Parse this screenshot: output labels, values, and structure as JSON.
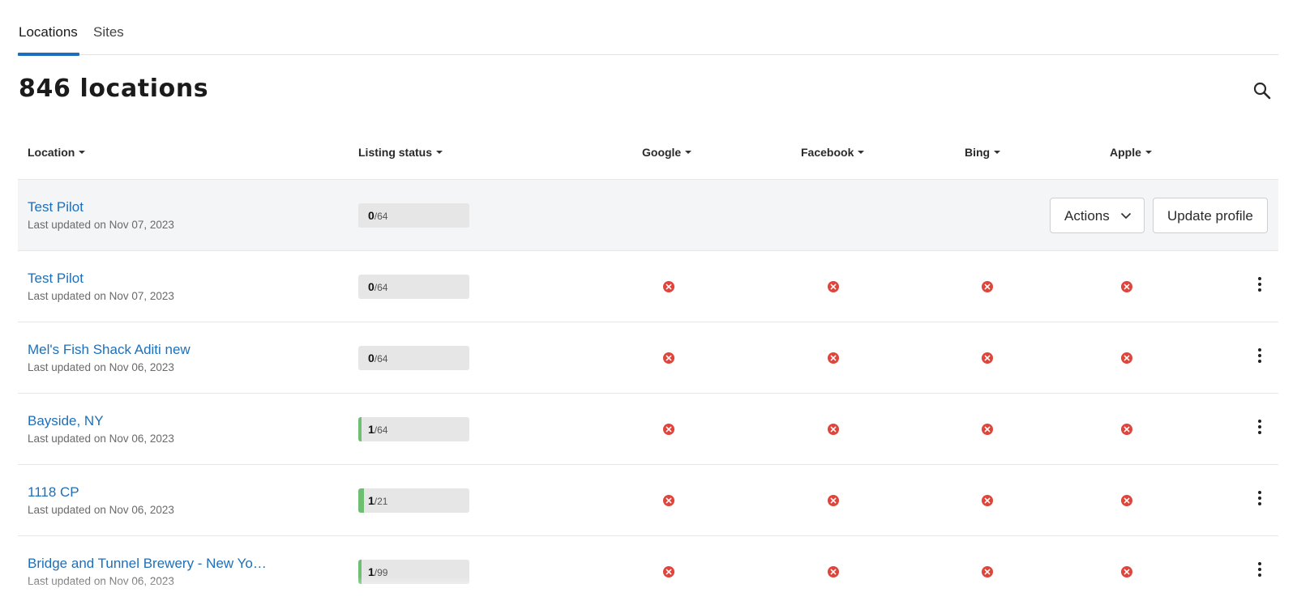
{
  "tabs": [
    {
      "label": "Locations",
      "active": true
    },
    {
      "label": "Sites",
      "active": false
    }
  ],
  "page_title": "846 locations",
  "columns": {
    "location": "Location",
    "listing_status": "Listing status",
    "google": "Google",
    "facebook": "Facebook",
    "bing": "Bing",
    "apple": "Apple"
  },
  "hover_actions": {
    "actions_label": "Actions",
    "update_label": "Update profile"
  },
  "rows": [
    {
      "name": "Test Pilot",
      "updated": "Last updated on Nov 07, 2023",
      "status_num": "0",
      "status_den": "/64",
      "progress": 0
    },
    {
      "name": "Test Pilot",
      "updated": "Last updated on Nov 07, 2023",
      "status_num": "0",
      "status_den": "/64",
      "progress": 0
    },
    {
      "name": "Mel's Fish Shack Aditi new",
      "updated": "Last updated on Nov 06, 2023",
      "status_num": "0",
      "status_den": "/64",
      "progress": 0
    },
    {
      "name": "Bayside, NY",
      "updated": "Last updated on Nov 06, 2023",
      "status_num": "1",
      "status_den": "/64",
      "progress": 0.016
    },
    {
      "name": "1118 CP",
      "updated": "Last updated on Nov 06, 2023",
      "status_num": "1",
      "status_den": "/21",
      "progress": 0.048
    },
    {
      "name": "Bridge and Tunnel Brewery - New Yo…",
      "updated": "Last updated on Nov 06, 2023",
      "status_num": "1",
      "status_den": "/99",
      "progress": 0.01
    }
  ],
  "icons": {
    "search": "search-icon",
    "status_error": "x-circle-icon",
    "row_menu": "more-vertical-icon",
    "dropdown": "chevron-down-icon"
  },
  "colors": {
    "accent": "#1c6fbf",
    "link": "#1e6fb8",
    "error": "#e0443a",
    "progress": "#6fbf73"
  }
}
